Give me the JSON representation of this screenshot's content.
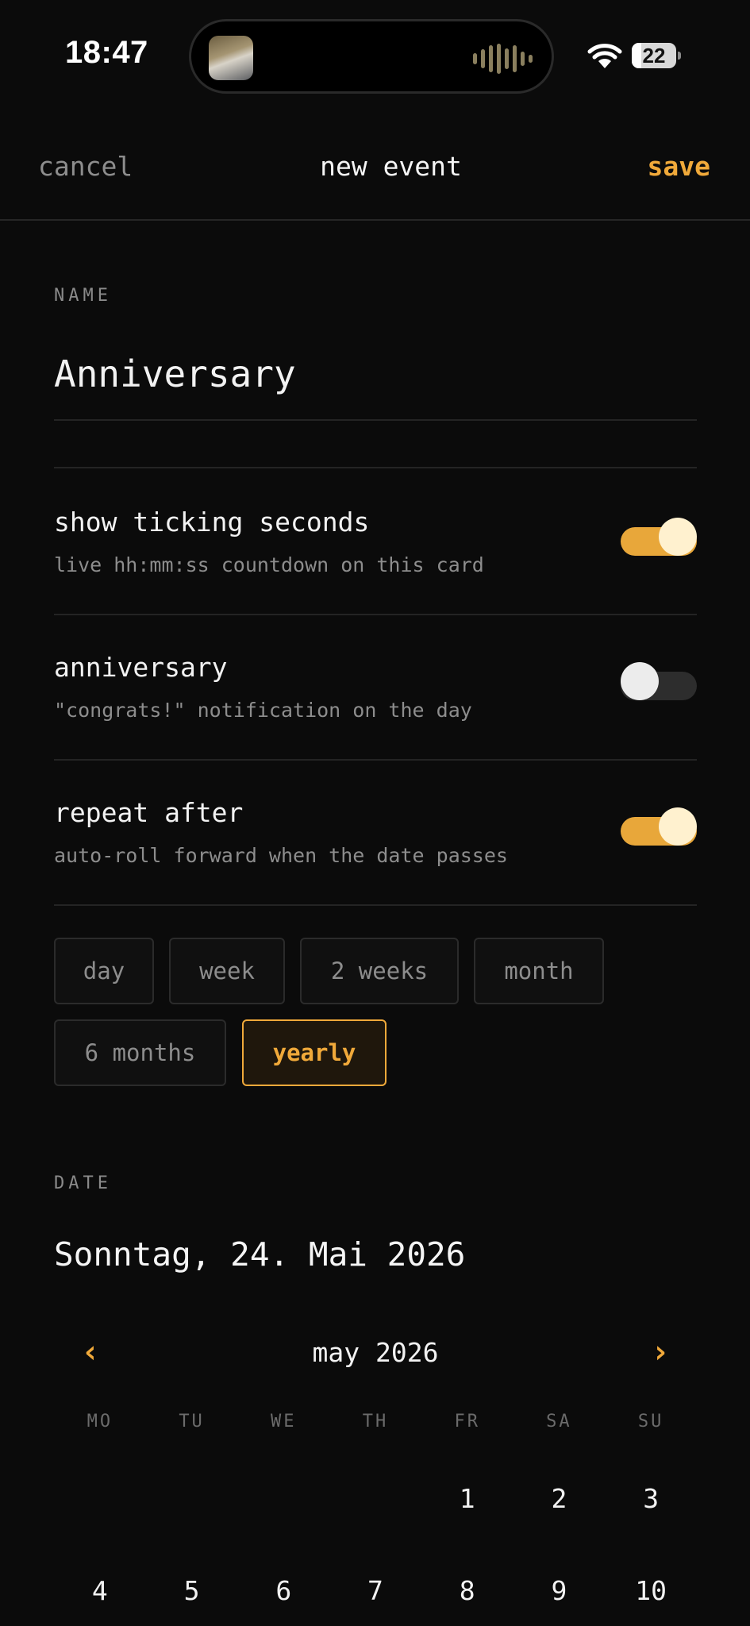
{
  "status_bar": {
    "time": "18:47",
    "battery": "22",
    "battery_level_percent": 22
  },
  "nav": {
    "cancel": "cancel",
    "title": "new event",
    "save": "save"
  },
  "name_section": {
    "label": "NAME",
    "value": "Anniversary"
  },
  "settings": [
    {
      "title": "show ticking seconds",
      "subtitle": "live hh:mm:ss countdown on this card",
      "on": true
    },
    {
      "title": "anniversary",
      "subtitle": "\"congrats!\" notification on the day",
      "on": false
    },
    {
      "title": "repeat after",
      "subtitle": "auto-roll forward when the date passes",
      "on": true
    }
  ],
  "repeat_options": [
    "day",
    "week",
    "2 weeks",
    "month",
    "6 months",
    "yearly"
  ],
  "repeat_selected": "yearly",
  "date_section": {
    "label": "DATE",
    "value": "Sonntag, 24. Mai 2026"
  },
  "calendar": {
    "month": "may 2026",
    "prev": "‹",
    "next": "›",
    "weekdays": [
      "MO",
      "TU",
      "WE",
      "TH",
      "FR",
      "SA",
      "SU"
    ],
    "weeks": [
      [
        "",
        "",
        "",
        "",
        "1",
        "2",
        "3"
      ],
      [
        "4",
        "5",
        "6",
        "7",
        "8",
        "9",
        "10"
      ]
    ]
  },
  "colors": {
    "accent": "#f0a93a",
    "background": "#0b0b0b",
    "muted": "#8d8d8d"
  }
}
